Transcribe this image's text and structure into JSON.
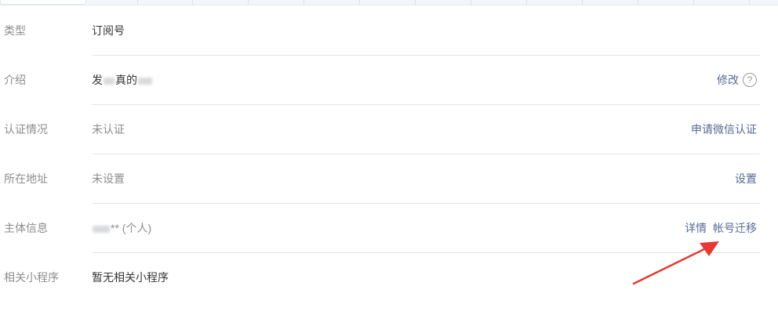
{
  "rows": [
    {
      "label": "类型",
      "value": "订阅号"
    },
    {
      "label": "介绍",
      "value_prefix": "发",
      "value_mid": "真的",
      "action_modify": "修改",
      "help_icon": "?"
    },
    {
      "label": "认证情况",
      "value": "未认证",
      "action": "申请微信认证"
    },
    {
      "label": "所在地址",
      "value": "未设置",
      "action": "设置"
    },
    {
      "label": "主体信息",
      "value": "** (个人)",
      "action_details": "详情",
      "action_migrate": "帐号迁移"
    },
    {
      "label": "相关小程序",
      "value": "暂无相关小程序"
    }
  ],
  "colors": {
    "link": "#576b95",
    "label": "#8d8d8d",
    "arrow": "#e53935"
  },
  "icons": [
    "help-icon",
    "arrow-annotation"
  ]
}
